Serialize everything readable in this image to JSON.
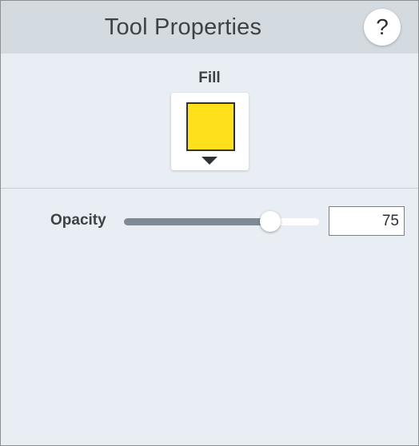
{
  "panel": {
    "title": "Tool Properties",
    "help_label": "?"
  },
  "fill": {
    "label": "Fill",
    "color": "#FFE01B"
  },
  "opacity": {
    "label": "Opacity",
    "value": "75",
    "fraction": 0.75,
    "track_fill_color": "#7F8B94"
  },
  "icons": {
    "help": "question-mark-icon",
    "dropdown": "caret-down-icon"
  }
}
